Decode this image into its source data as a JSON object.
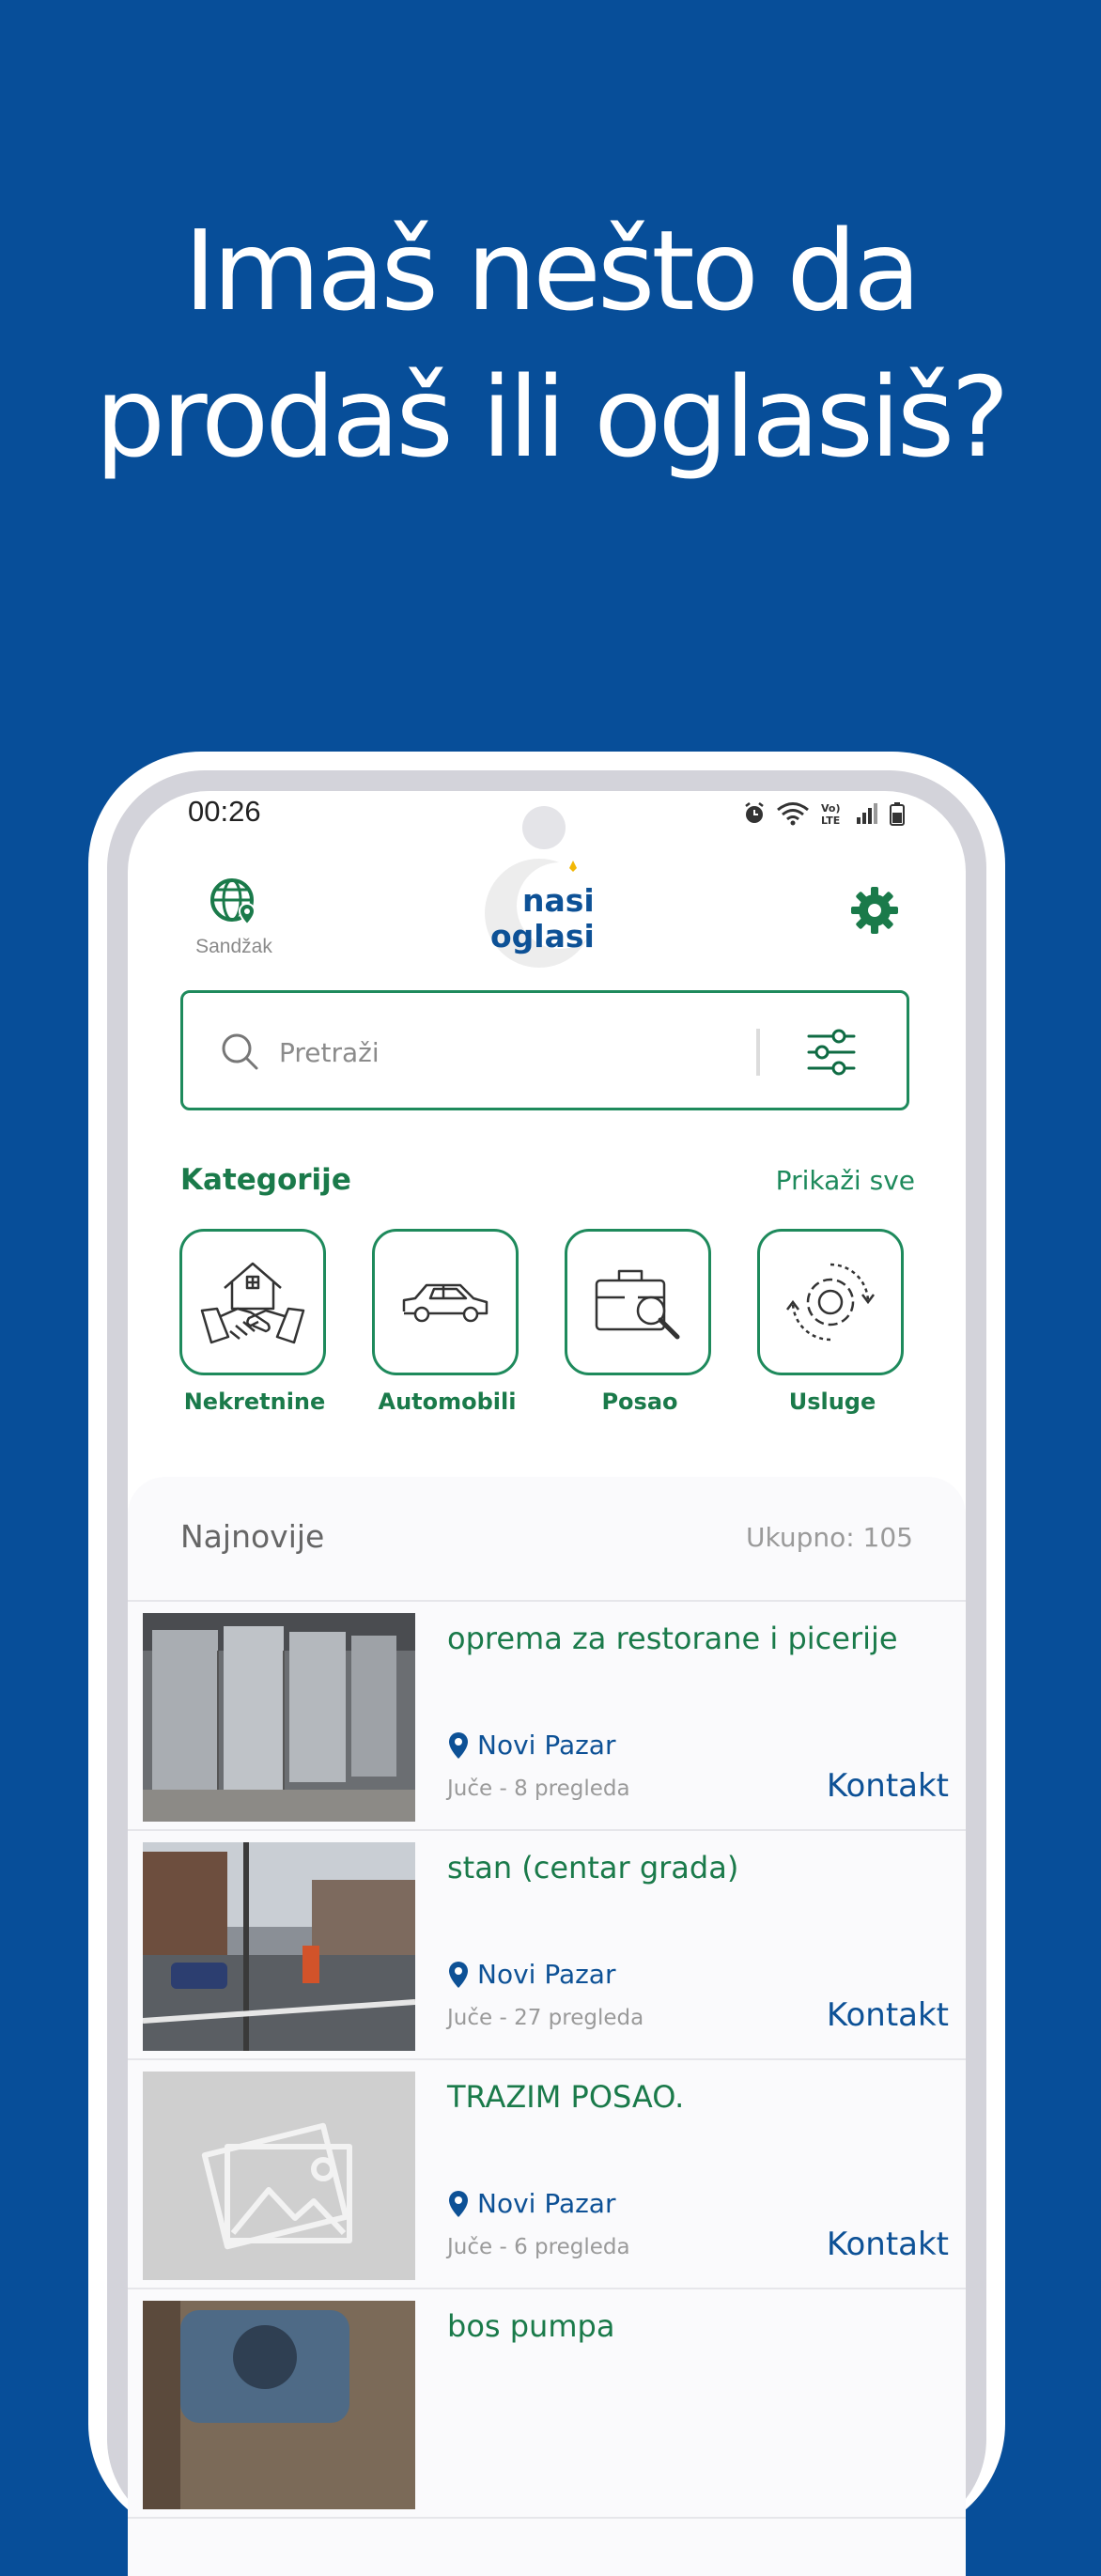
{
  "headline": {
    "line1": "Imaš nešto da",
    "line2": "prodaš ili oglasiš?"
  },
  "status_bar": {
    "time": "00:26"
  },
  "header": {
    "location_label": "Sandžak",
    "logo_top": "nasi",
    "logo_bottom": "oglasi"
  },
  "search": {
    "placeholder": "Pretraži"
  },
  "categories": {
    "title": "Kategorije",
    "show_all": "Prikaži sve",
    "items": [
      {
        "label": "Nekretnine",
        "icon": "house-handshake-icon"
      },
      {
        "label": "Automobili",
        "icon": "car-icon"
      },
      {
        "label": "Posao",
        "icon": "briefcase-search-icon"
      },
      {
        "label": "Usluge",
        "icon": "gear-services-icon"
      }
    ]
  },
  "latest": {
    "title": "Najnovije",
    "count": "Ukupno: 105",
    "listings": [
      {
        "title": "oprema za restorane i picerije",
        "location": "Novi Pazar",
        "meta": "Juče - 8 pregleda",
        "contact": "Kontakt",
        "image": "steel-refrigerators"
      },
      {
        "title": "stan (centar grada)",
        "location": "Novi Pazar",
        "meta": "Juče - 27 pregleda",
        "contact": "Kontakt",
        "image": "street-scene"
      },
      {
        "title": "TRAZIM POSAO.",
        "location": "Novi Pazar",
        "meta": "Juče - 6 pregleda",
        "contact": "Kontakt",
        "image": "placeholder-image"
      },
      {
        "title": "bos pumpa",
        "location": "",
        "meta": "",
        "contact": "",
        "image": "pump-photo"
      }
    ]
  },
  "colors": {
    "background": "#074E99",
    "brand_green": "#1A7A4A",
    "brand_blue": "#0D5196"
  }
}
